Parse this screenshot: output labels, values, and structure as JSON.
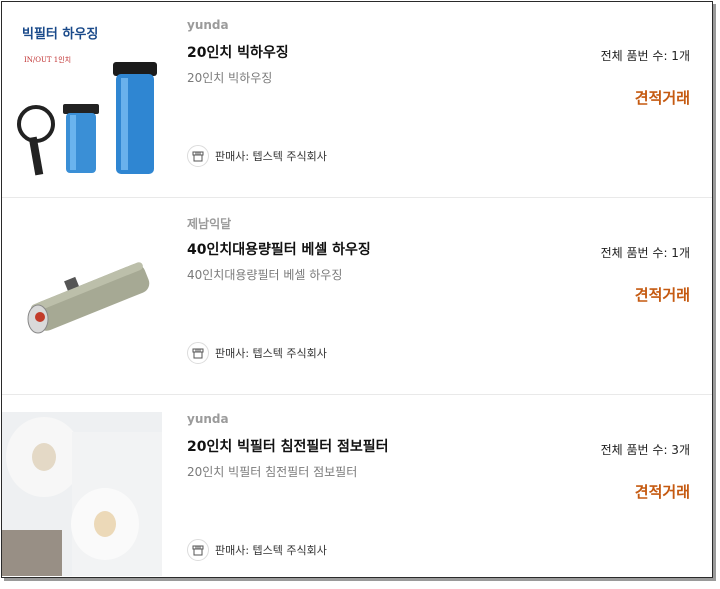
{
  "products": [
    {
      "brand": "yunda",
      "title": "20인치 빅하우징",
      "subtitle": "20인치 빅하우징",
      "count": "전체 품번 수: 1개",
      "action": "견적거래",
      "seller": "판매사: 텝스텍 주식회사",
      "image_caption_1": "빅필터 하우징",
      "image_caption_2": "IN/OUT 1인치"
    },
    {
      "brand": "제남익달",
      "title": "40인치대용량필터 베셀 하우징",
      "subtitle": "40인치대용량필터 베셀 하우징",
      "count": "전체 품번 수: 1개",
      "action": "견적거래",
      "seller": "판매사: 텝스텍 주식회사"
    },
    {
      "brand": "yunda",
      "title": "20인치 빅필터 침전필터 점보필터",
      "subtitle": "20인치 빅필터 침전필터 점보필터",
      "count": "전체 품번 수: 3개",
      "action": "견적거래",
      "seller": "판매사: 텝스텍 주식회사"
    }
  ],
  "colors": {
    "action": "#c55a11",
    "brand": "#9b9b9b"
  },
  "icons": {
    "seller": "shop-icon"
  }
}
